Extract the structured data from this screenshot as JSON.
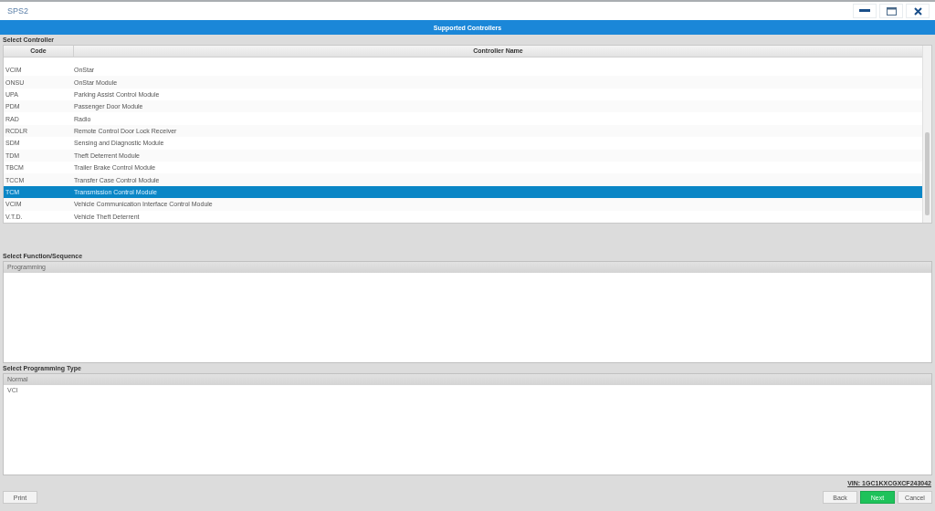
{
  "window": {
    "title": "SPS2"
  },
  "header": {
    "title": "Supported Controllers"
  },
  "controller_section": {
    "label": "Select Controller",
    "columns": [
      "Code",
      "Controller Name"
    ],
    "rows": [
      {
        "code": "VCIM",
        "name": "OnStar",
        "selected": false
      },
      {
        "code": "ONSU",
        "name": "OnStar Module",
        "selected": false
      },
      {
        "code": "UPA",
        "name": "Parking Assist Control Module",
        "selected": false
      },
      {
        "code": "PDM",
        "name": "Passenger Door Module",
        "selected": false
      },
      {
        "code": "RAD",
        "name": "Radio",
        "selected": false
      },
      {
        "code": "RCDLR",
        "name": "Remote Control Door Lock Receiver",
        "selected": false
      },
      {
        "code": "SDM",
        "name": "Sensing and Diagnostic Module",
        "selected": false
      },
      {
        "code": "TDM",
        "name": "Theft Deterrent Module",
        "selected": false
      },
      {
        "code": "TBCM",
        "name": "Trailer Brake Control Module",
        "selected": false
      },
      {
        "code": "TCCM",
        "name": "Transfer Case Control Module",
        "selected": false
      },
      {
        "code": "TCM",
        "name": "Transmission Control Module",
        "selected": true
      },
      {
        "code": "VCIM",
        "name": "Vehicle Communication Interface Control Module",
        "selected": false
      },
      {
        "code": "V.T.D.",
        "name": "Vehicle Theft Deterrent",
        "selected": false
      }
    ]
  },
  "function_section": {
    "label": "Select Function/Sequence",
    "items": [
      {
        "text": "Programming",
        "selected": true
      }
    ]
  },
  "type_section": {
    "label": "Select Programming Type",
    "items": [
      {
        "text": "Normal",
        "selected": true
      },
      {
        "text": "VCI",
        "selected": false
      }
    ]
  },
  "vin": "VIN: 1GC1KXCGXCF243042",
  "buttons": [
    {
      "label": "Print",
      "kind": "plain"
    },
    {
      "label": "Back",
      "kind": "plain"
    },
    {
      "label": "Next",
      "kind": "primary"
    },
    {
      "label": "Cancel",
      "kind": "plain"
    }
  ]
}
